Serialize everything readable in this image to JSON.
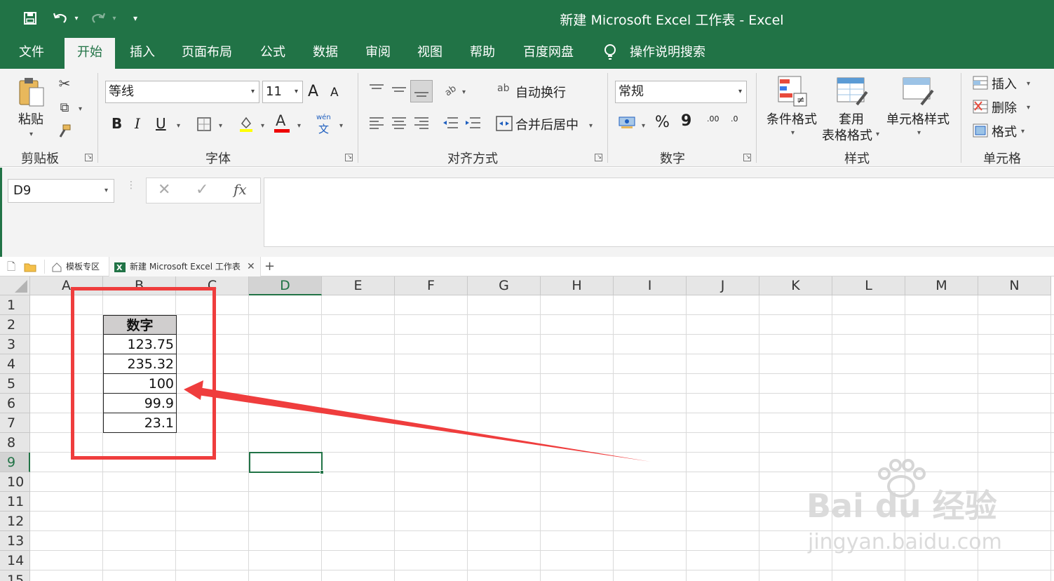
{
  "titlebar": {
    "title": "新建 Microsoft Excel 工作表  -  Excel"
  },
  "menu": {
    "tabs": [
      "文件",
      "开始",
      "插入",
      "页面布局",
      "公式",
      "数据",
      "审阅",
      "视图",
      "帮助",
      "百度网盘"
    ],
    "active_index": 1,
    "tell_me": "操作说明搜索"
  },
  "ribbon": {
    "clipboard": {
      "paste": "粘贴",
      "label": "剪贴板"
    },
    "font": {
      "name": "等线",
      "size": "11",
      "label": "字体",
      "bold": "B",
      "italic": "I",
      "underline": "U",
      "grow": "A",
      "shrink": "A",
      "phonetic_top": "wén",
      "phonetic_bottom": "文",
      "font_color_glyph": "A"
    },
    "alignment": {
      "wrap": "自动换行",
      "merge": "合并后居中",
      "label": "对齐方式",
      "wrap_glyph": "ab"
    },
    "number": {
      "format": "常规",
      "label": "数字",
      "percent": "%",
      "comma": "9",
      "inc_decimal": ".00",
      "dec_decimal": ".0"
    },
    "styles": {
      "conditional": "条件格式",
      "table_line1": "套用",
      "table_line2": "表格格式",
      "cell_styles": "单元格样式",
      "label": "样式"
    },
    "cells": {
      "insert": "插入",
      "delete": "删除",
      "format": "格式",
      "label": "单元格"
    }
  },
  "formula_bar": {
    "name_box": "D9",
    "fx": "fx",
    "content": ""
  },
  "workbook_tabs": {
    "template_tab": "模板专区",
    "file_tab": "新建 Microsoft Excel 工作表",
    "add": "+"
  },
  "sheet": {
    "columns": [
      "A",
      "B",
      "C",
      "D",
      "E",
      "F",
      "G",
      "H",
      "I",
      "J",
      "K",
      "L",
      "M",
      "N"
    ],
    "rows": [
      "1",
      "2",
      "3",
      "4",
      "5",
      "6",
      "7",
      "8",
      "9",
      "10",
      "11",
      "12",
      "13",
      "14",
      "15"
    ],
    "selected_column": "D",
    "selected_row": "9",
    "header_cell": "数字",
    "values": [
      "123.75",
      "235.32",
      "100",
      "99.9",
      "23.1"
    ]
  },
  "watermark": {
    "brand": "Bai du 经验",
    "url": "jingyan.baidu.com"
  },
  "colors": {
    "excel_green": "#217346",
    "annotation_red": "#ef3d3d"
  }
}
